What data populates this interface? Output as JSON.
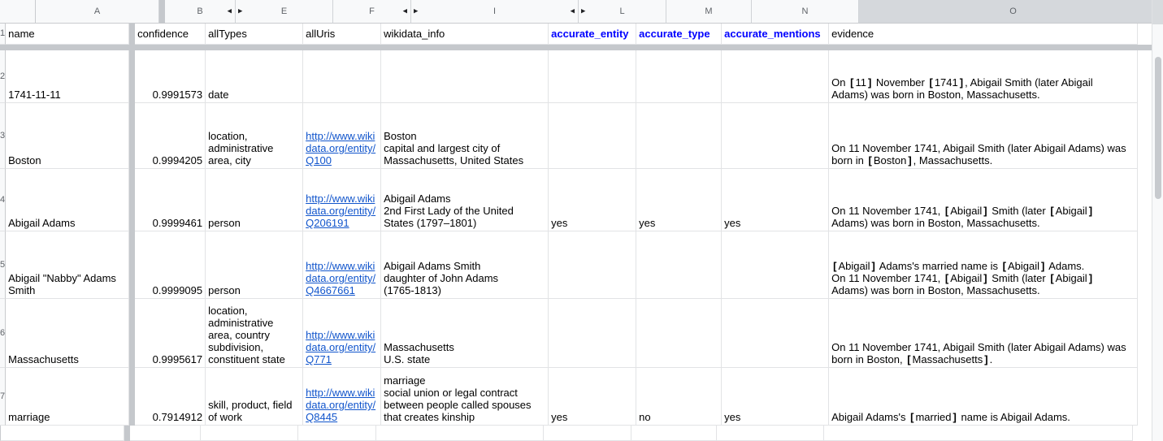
{
  "columns": [
    {
      "letter": "A"
    },
    {
      "letter": "B",
      "right_arrow": "◀"
    },
    {
      "letter": "E",
      "left_arrow": "▶"
    },
    {
      "letter": "F",
      "right_arrow": "◀"
    },
    {
      "letter": "I",
      "left_arrow": "▶",
      "right_arrow": "◀"
    },
    {
      "letter": "L",
      "left_arrow": "▶"
    },
    {
      "letter": "M"
    },
    {
      "letter": "N"
    },
    {
      "letter": "O"
    }
  ],
  "header_row": {
    "num": "1",
    "name": "name",
    "confidence": "confidence",
    "allTypes": "allTypes",
    "allUris": "allUris",
    "wikidata_info": "wikidata_info",
    "accurate_entity": "accurate_entity",
    "accurate_type": "accurate_type",
    "accurate_mentions": "accurate_mentions",
    "evidence": "evidence"
  },
  "rows": [
    {
      "num": "2",
      "name": "1741-11-11",
      "confidence": "0.9991573",
      "allTypes": "date",
      "allUris": "",
      "wikidata_info": "",
      "accurate_entity": "",
      "accurate_type": "",
      "accurate_mentions": "",
      "evidence": "On 【11】 November 【1741】, Abigail Smith (later Abigail\nAdams) was born in Boston, Massachusetts."
    },
    {
      "num": "3",
      "name": "Boston",
      "confidence": "0.9994205",
      "allTypes": "location,\nadministrative\narea, city",
      "allUris": "http://www.wiki\ndata.org/entity/\nQ100",
      "wikidata_info": "Boston\ncapital and largest city of\nMassachusetts, United States",
      "accurate_entity": "",
      "accurate_type": "",
      "accurate_mentions": "",
      "evidence": "On 11 November 1741, Abigail Smith (later Abigail Adams) was\nborn in 【Boston】, Massachusetts."
    },
    {
      "num": "4",
      "name": "Abigail Adams",
      "confidence": "0.9999461",
      "allTypes": "person",
      "allUris": "http://www.wiki\ndata.org/entity/\nQ206191",
      "wikidata_info": "Abigail Adams\n2nd First Lady of the United\nStates (1797–1801)",
      "accurate_entity": "yes",
      "accurate_type": "yes",
      "accurate_mentions": "yes",
      "evidence": "On 11 November 1741, 【Abigail】 Smith (later 【Abigail】\nAdams) was born in Boston, Massachusetts."
    },
    {
      "num": "5",
      "name": "Abigail \"Nabby\" Adams\nSmith",
      "confidence": "0.9999095",
      "allTypes": "person",
      "allUris": "http://www.wiki\ndata.org/entity/\nQ4667661",
      "wikidata_info": "Abigail Adams Smith\ndaughter of John Adams\n(1765-1813)",
      "accurate_entity": "",
      "accurate_type": "",
      "accurate_mentions": "",
      "evidence": "【Abigail】 Adams's married name is 【Abigail】 Adams.\nOn 11 November 1741, 【Abigail】 Smith (later 【Abigail】\nAdams) was born in Boston, Massachusetts."
    },
    {
      "num": "6",
      "name": "Massachusetts",
      "confidence": "0.9995617",
      "allTypes": "location,\nadministrative\narea, country\nsubdivision,\nconstituent state",
      "allUris": "http://www.wiki\ndata.org/entity/\nQ771",
      "wikidata_info": "Massachusetts\nU.S. state",
      "accurate_entity": "",
      "accurate_type": "",
      "accurate_mentions": "",
      "evidence": "On 11 November 1741, Abigail Smith (later Abigail Adams) was\nborn in Boston, 【Massachusetts】."
    },
    {
      "num": "7",
      "name": "marriage",
      "confidence": "0.7914912",
      "allTypes": "skill, product, field\nof work",
      "allUris": "http://www.wiki\ndata.org/entity/\nQ8445",
      "wikidata_info": "marriage\nsocial union or legal contract\nbetween people called spouses\nthat creates kinship",
      "accurate_entity": "yes",
      "accurate_type": "no",
      "accurate_mentions": "yes",
      "evidence": "Abigail Adams's 【married】 name is Abigail Adams."
    }
  ],
  "colors": {
    "link": "#1155cc",
    "accuracy_header_text": "#0000ff",
    "frozen_divider": "#c5c8cc",
    "grid_line": "#e2e3e5",
    "header_bg": "#f8f9fa",
    "selected_column_header_bg": "#d5d8dc",
    "header_text": "#5f6368"
  }
}
